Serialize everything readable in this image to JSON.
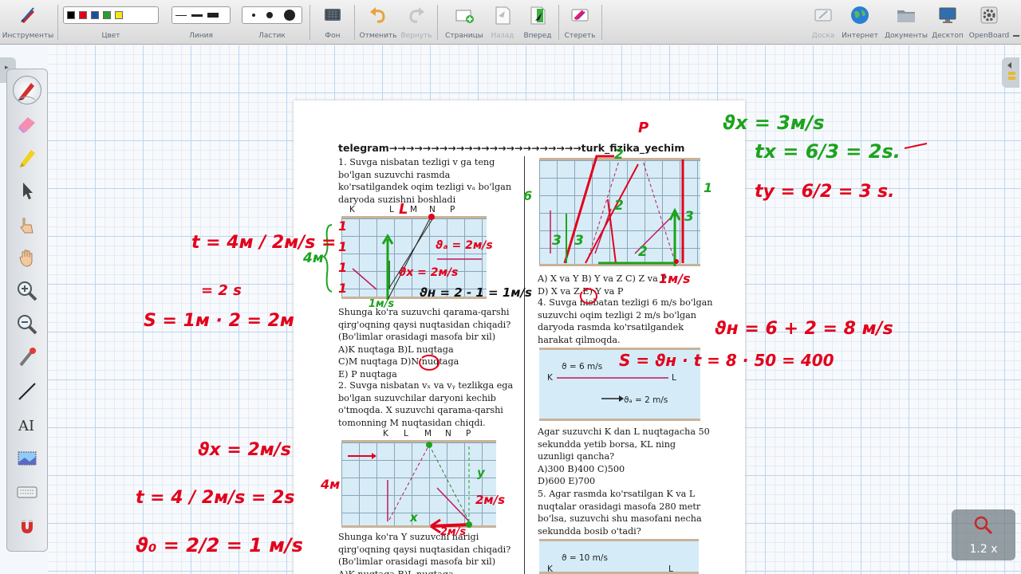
{
  "toolbar": {
    "instruments": "Инструменты",
    "color": "Цвет",
    "line": "Линия",
    "eraser": "Ластик",
    "background": "Фон",
    "undo": "Отменить",
    "redo": "Вернуть",
    "pages": "Страницы",
    "back": "Назад",
    "forward": "Вперед",
    "clear": "Стереть",
    "board": "Доска",
    "internet": "Интернет",
    "documents": "Документы",
    "desktop": "Десктоп",
    "openboard": "OpenBoard",
    "colors": [
      "#000000",
      "#e3001b",
      "#1a4fa0",
      "#2aa02a",
      "#f4e61a"
    ]
  },
  "zoom": {
    "value": "1.2 x"
  },
  "document": {
    "header": "telegram→→→→→→→→→→→→→→→→→→→→→→→turk_fizika_yechim",
    "q1": [
      "1. Suvga nisbatan tezligi v ga teng",
      "bo'lgan suzuvchi rasmda",
      "ko'rsatilgandek oqim tezligi vₐ bo'lgan",
      "daryoda suzishni boshladi"
    ],
    "fig1_labels": [
      "K",
      "L",
      "M",
      "N",
      "P"
    ],
    "q1_after": [
      "Shunga ko'ra suzuvchi qarama-qarshi",
      "qirg'oqning qaysi nuqtasidan chiqadi?",
      "(Bo'limlar orasidagi masofa bir xil)",
      "A)K nuqtaga          B)L nuqtaga",
      "C)M nuqtaga          D)N nuqtaga",
      "E) P nuqtaga"
    ],
    "q2": [
      "2. Suvga nisbatan vₓ va vᵧ tezlikga ega",
      "bo'lgan suzuvchilar daryoni kechib",
      "o'tmoqda. X suzuvchi qarama-qarshi",
      "tomonning M nuqtasidan chiqdi."
    ],
    "fig2_labels": [
      "K",
      "L",
      "M",
      "N",
      "P"
    ],
    "q2_after": [
      "Shunga ko'ra Y suzuvchi narigi",
      "qirg'oqning qaysi nuqtasidan chiqadi?",
      "(Bo'limlar orasidagi masofa bir xil)",
      "A)K nuqtaga          B)L nuqtaga"
    ],
    "q3_answers": [
      "A) X va Y  B) Y va Z  C) Z va P",
      "D) X va Z  E) Y va P"
    ],
    "q4": [
      "4. Suvga nisbatan tezligi 6 m/s bo'lgan",
      "suzuvchi oqim tezligi 2 m/s bo'lgan",
      "daryoda rasmda ko'rsatilgandek",
      "harakat qilmoqda."
    ],
    "fig4": {
      "v": "ϑ = 6 m/s",
      "k": "K",
      "l": "L",
      "va": "ϑₐ = 2 m/s"
    },
    "q4_after": [
      "Agar suzuvchi K dan L nuqtagacha 50",
      "sekundda yetib borsa, KL ning",
      "uzunligi qancha?",
      "A)300         B)400          C)500",
      "D)600         E)700"
    ],
    "q5": [
      "5. Agar rasmda ko'rsatilgan K va L",
      "nuqtalar orasidagi masofa 280 metr",
      "bo'lsa, suzuvchi shu masofani necha",
      "sekundda bosib o'tadi?"
    ],
    "fig5": {
      "v": "ϑ = 10 m/s",
      "k": "K",
      "l": "L"
    }
  },
  "annotations": {
    "t_eq": "t = 4м / 2м/s =",
    "eq_2s": "= 2 s",
    "s_eq": "S = 1м · 2 = 2м",
    "left_4m": "4м",
    "ones": [
      "1",
      "1",
      "1",
      "1"
    ],
    "top_l": "L",
    "va_2ms": "ϑₐ = 2м/s",
    "vx_2ms": "ϑx = 2м/s",
    "vn": "ϑн = 2 - 1 = 1м/s",
    "one_ms": "1м/s",
    "vx_right": "ϑx = 3м/s",
    "tx": "tx = 6/3 = 2s.",
    "ty": "ty = 6/2 = 3 s.",
    "p": "P",
    "six": "6",
    "r1": "1",
    "twos": [
      "2",
      "2",
      "2",
      "3",
      "3",
      "3"
    ],
    "vn_sum": "ϑн = 6 + 2 = 8 м/s",
    "s_calc": "S = ϑн · t = 8 · 50 = 400",
    "vx2": "ϑx = 2м/s",
    "t2": "t = 4 / 2м/s = 2s",
    "v0": "ϑ₀ = 2/2 = 1 м/s",
    "fig2_4m": "4м",
    "fig2_2ms": "2м/s",
    "fig2_2ms_b": "2м/s",
    "x": "x",
    "y": "y"
  }
}
